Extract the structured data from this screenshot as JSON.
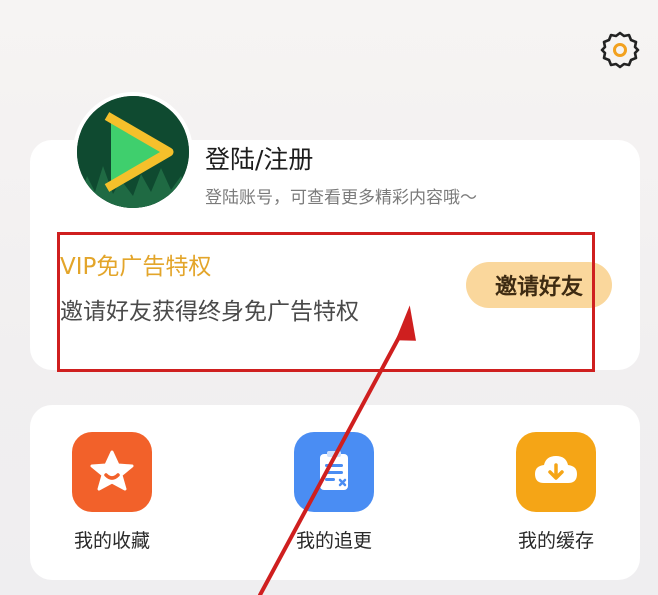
{
  "user": {
    "login_title": "登陆/注册",
    "login_subtitle": "登陆账号，可查看更多精彩内容哦～"
  },
  "vip": {
    "title": "VIP免广告特权",
    "description": "邀请好友获得终身免广告特权",
    "invite_label": "邀请好友"
  },
  "actions": [
    {
      "label": "我的收藏",
      "icon": "star-icon",
      "color": "#f2612a"
    },
    {
      "label": "我的追更",
      "icon": "document-icon",
      "color": "#4a8df3"
    },
    {
      "label": "我的缓存",
      "icon": "cloud-download-icon",
      "color": "#f5a516"
    }
  ],
  "colors": {
    "vip_gold": "#e3a52a",
    "invite_bg": "#fad79c",
    "annotation_red": "#cf1f1f"
  },
  "icons": {
    "settings": "gear-icon",
    "avatar": "play-logo-icon"
  }
}
